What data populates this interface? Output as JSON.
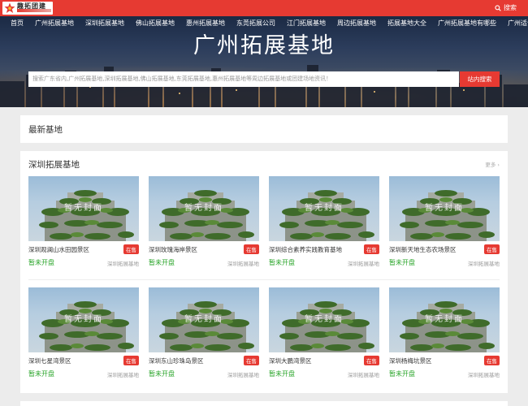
{
  "header": {
    "logo_text": "趣拓团建",
    "search_label": "搜索",
    "brand_color": "#e63a32"
  },
  "nav": {
    "items": [
      {
        "label": "首页"
      },
      {
        "label": "广州拓展基地"
      },
      {
        "label": "深圳拓展基地"
      },
      {
        "label": "佛山拓展基地"
      },
      {
        "label": "惠州拓展基地"
      },
      {
        "label": "东莞拓展公司"
      },
      {
        "label": "江门拓展基地"
      },
      {
        "label": "周边拓展基地"
      },
      {
        "label": "拓展基地大全"
      },
      {
        "label": "广州拓展基地有哪些"
      },
      {
        "label": "广州适合团建的地方"
      }
    ]
  },
  "hero": {
    "title": "广州拓展基地",
    "search_placeholder": "搜索广东省内,广州拓展基地,深圳拓展基地,佛山拓展基地,东莞拓展基地,惠州拓展基地等周边拓展基地或团建场地资讯！",
    "search_button": "站内搜索"
  },
  "latest": {
    "title": "最新基地"
  },
  "shenzhen": {
    "title": "深圳拓展基地",
    "more": "更多 ›",
    "placeholder_watermark": "暂无封面",
    "cards": [
      {
        "name": "深圳观澜山水田园景区",
        "badge": "在售",
        "status": "暂未开盘",
        "category": "深圳拓展基地"
      },
      {
        "name": "深圳玫瑰海岸景区",
        "badge": "在售",
        "status": "暂未开盘",
        "category": "深圳拓展基地"
      },
      {
        "name": "深圳综合素养实践教育基地",
        "badge": "在售",
        "status": "暂未开盘",
        "category": "深圳拓展基地"
      },
      {
        "name": "深圳新天地生态农场景区",
        "badge": "在售",
        "status": "暂未开盘",
        "category": "深圳拓展基地"
      },
      {
        "name": "深圳七星湾景区",
        "badge": "在售",
        "status": "暂未开盘",
        "category": "深圳拓展基地"
      },
      {
        "name": "深圳东山珍珠岛景区",
        "badge": "在售",
        "status": "暂未开盘",
        "category": "深圳拓展基地"
      },
      {
        "name": "深圳大鹏湾景区",
        "badge": "在售",
        "status": "暂未开盘",
        "category": "深圳拓展基地"
      },
      {
        "name": "深圳杨梅坑景区",
        "badge": "在售",
        "status": "暂未开盘",
        "category": "深圳拓展基地"
      }
    ]
  }
}
